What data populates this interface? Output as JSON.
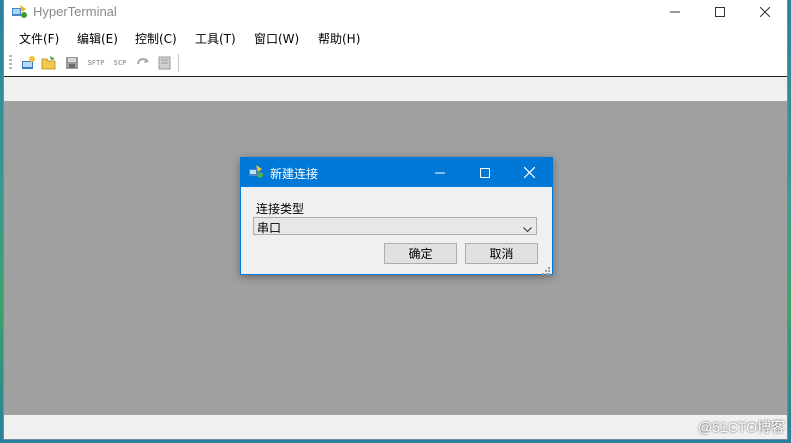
{
  "window": {
    "title": "HyperTerminal",
    "minimize_symbol": "—",
    "maximize_symbol": "□",
    "close_symbol": "✕"
  },
  "menu": [
    {
      "label": "文件(F)"
    },
    {
      "label": "编辑(E)"
    },
    {
      "label": "控制(C)"
    },
    {
      "label": "工具(T)"
    },
    {
      "label": "窗口(W)"
    },
    {
      "label": "帮助(H)"
    }
  ],
  "toolbar": {
    "icons": [
      "new-connection-icon",
      "open-folder-icon",
      "save-icon",
      "sftp-icon",
      "scp-icon",
      "reconnect-icon",
      "properties-icon"
    ],
    "sftp_label": "SFTP",
    "scp_label": "SCP"
  },
  "dialog": {
    "title": "新建连接",
    "field_label": "连接类型",
    "connection_type": "串口",
    "ok_label": "确定",
    "cancel_label": "取消"
  },
  "watermark": "@51CTO博客",
  "colors": {
    "accent": "#0078d7",
    "workspace": "#a0a0a0",
    "chrome": "#f0f0f0"
  }
}
